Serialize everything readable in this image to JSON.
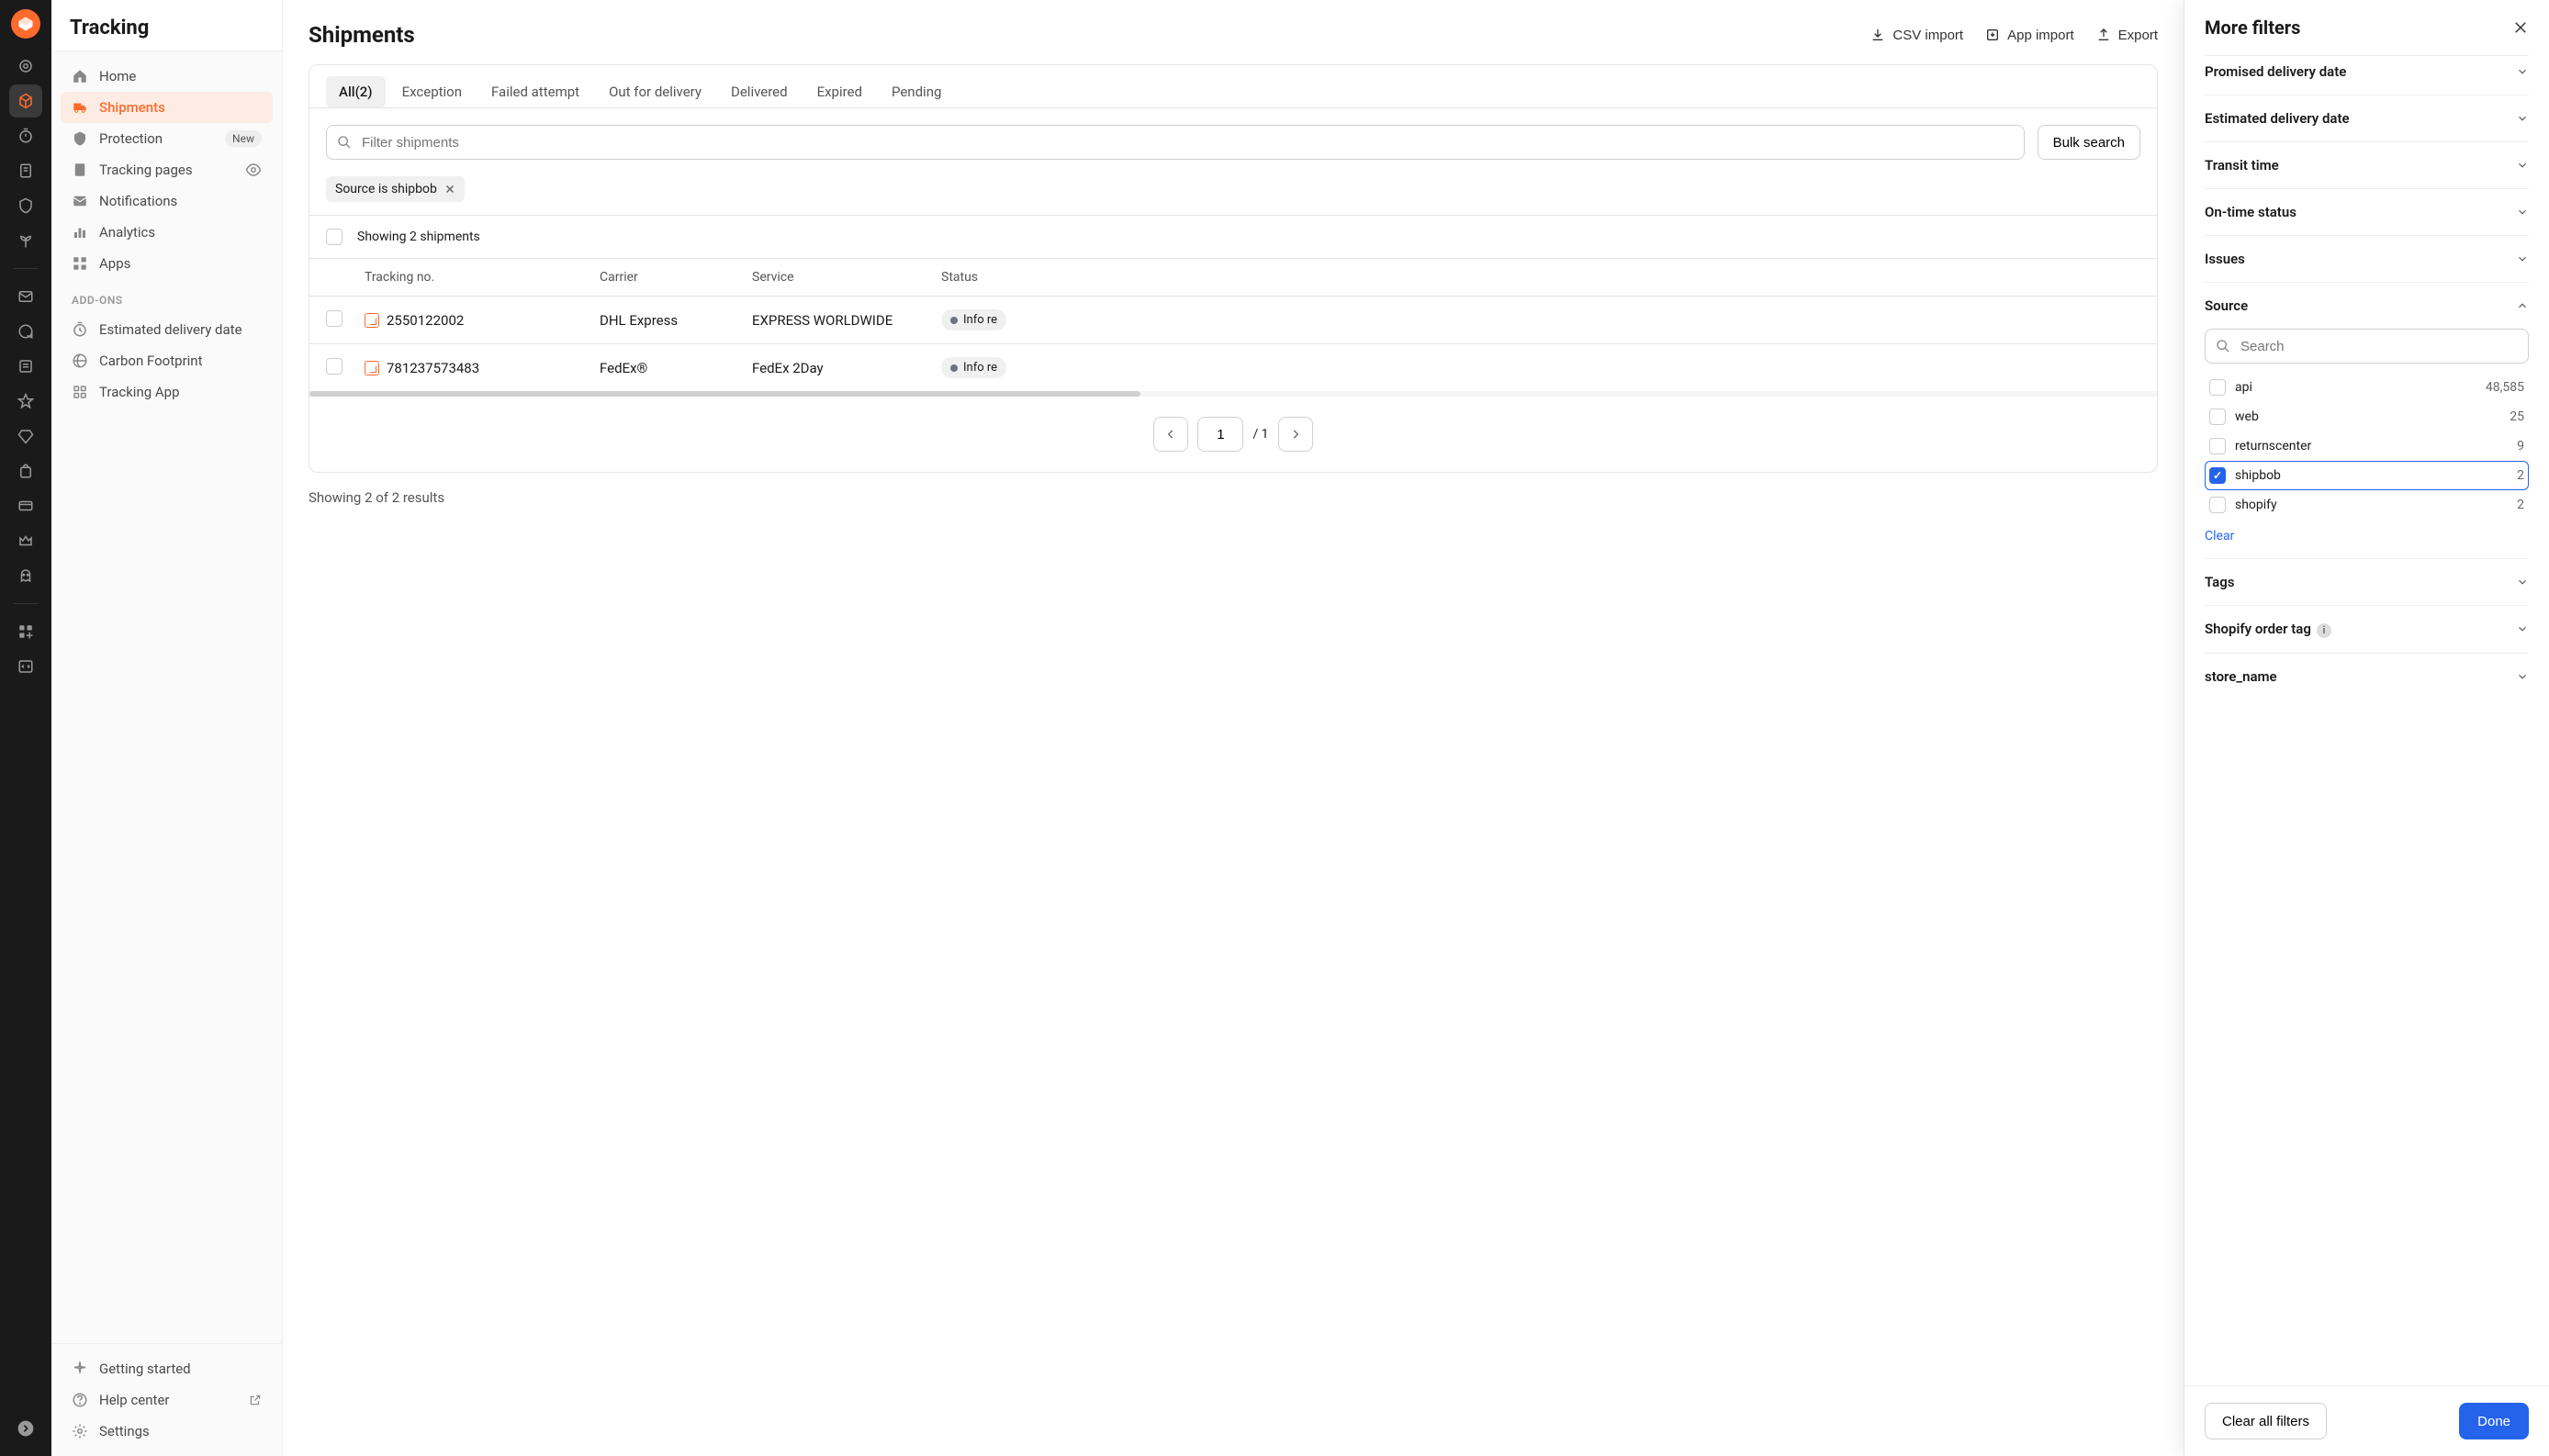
{
  "rail": {
    "active_index": 1
  },
  "sidebar": {
    "title": "Tracking",
    "items": [
      {
        "label": "Home",
        "icon": "home"
      },
      {
        "label": "Shipments",
        "icon": "truck",
        "active": true
      },
      {
        "label": "Protection",
        "icon": "shield",
        "badge": "New"
      },
      {
        "label": "Tracking pages",
        "icon": "page",
        "eye": true
      },
      {
        "label": "Notifications",
        "icon": "mail"
      },
      {
        "label": "Analytics",
        "icon": "chart"
      },
      {
        "label": "Apps",
        "icon": "grid"
      }
    ],
    "addons_label": "ADD-ONS",
    "addons": [
      {
        "label": "Estimated delivery date",
        "icon": "clock"
      },
      {
        "label": "Carbon Footprint",
        "icon": "leaf"
      },
      {
        "label": "Tracking App",
        "icon": "app"
      }
    ],
    "footer": {
      "getting_started": "Getting started",
      "help": "Help center",
      "settings": "Settings"
    }
  },
  "main": {
    "heading": "Shipments",
    "actions": {
      "csv_import": "CSV import",
      "app_import": "App import",
      "export": "Export"
    },
    "tabs": [
      {
        "label": "All(2)",
        "active": true
      },
      {
        "label": "Exception"
      },
      {
        "label": "Failed attempt"
      },
      {
        "label": "Out for delivery"
      },
      {
        "label": "Delivered"
      },
      {
        "label": "Expired"
      },
      {
        "label": "Pending"
      }
    ],
    "search_placeholder": "Filter shipments",
    "bulk_search": "Bulk search",
    "chip": {
      "text": "Source is shipbob"
    },
    "showing_text": "Showing 2 shipments",
    "columns": {
      "tracking": "Tracking no.",
      "carrier": "Carrier",
      "service": "Service",
      "status": "Status"
    },
    "rows": [
      {
        "tracking": "2550122002",
        "carrier": "DHL Express",
        "service": "EXPRESS WORLDWIDE",
        "status": "Info re"
      },
      {
        "tracking": "781237573483",
        "carrier": "FedEx®",
        "service": "FedEx 2Day",
        "status": "Info re"
      }
    ],
    "pager": {
      "page": "1",
      "total": "/ 1"
    },
    "results_line": "Showing 2 of 2 results"
  },
  "panel": {
    "title": "More filters",
    "sections": {
      "promised": "Promised delivery date",
      "estimated": "Estimated delivery date",
      "transit": "Transit time",
      "ontime": "On-time status",
      "issues": "Issues",
      "source": "Source",
      "tags": "Tags",
      "shopify_tag": "Shopify order tag",
      "store": "store_name"
    },
    "source": {
      "search_placeholder": "Search",
      "options": [
        {
          "label": "api",
          "count": "48,585",
          "checked": false
        },
        {
          "label": "web",
          "count": "25",
          "checked": false
        },
        {
          "label": "returnscenter",
          "count": "9",
          "checked": false
        },
        {
          "label": "shipbob",
          "count": "2",
          "checked": true
        },
        {
          "label": "shopify",
          "count": "2",
          "checked": false
        }
      ],
      "clear": "Clear"
    },
    "footer": {
      "clear_all": "Clear all filters",
      "done": "Done"
    }
  }
}
